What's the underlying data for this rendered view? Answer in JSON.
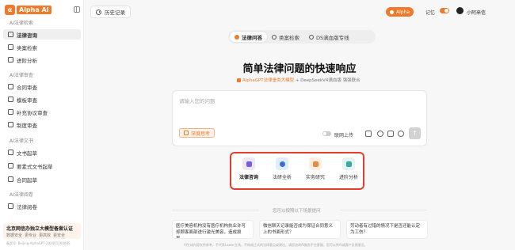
{
  "sidebar": {
    "logo_text": "Alpha AI",
    "sections": [
      {
        "title": "AI法律检索"
      },
      {
        "title": "AI法律审查"
      },
      {
        "title": "AI法律文书"
      },
      {
        "title": "AI法律阅卷"
      }
    ],
    "items": [
      {
        "label": "法律咨询"
      },
      {
        "label": "类案检索"
      },
      {
        "label": "进阶分析"
      },
      {
        "label": "合同审查"
      },
      {
        "label": "模板审查"
      },
      {
        "label": "补充协议审查"
      },
      {
        "label": "制度审查"
      },
      {
        "label": "文书起草"
      },
      {
        "label": "要素式文书起草"
      },
      {
        "label": "合同起草"
      },
      {
        "label": "法律阅卷"
      }
    ],
    "promo": {
      "title": "北京网信办独立大模型备案认证",
      "tags": [
        "数据安全",
        "更专业",
        "更高效",
        "更安全"
      ]
    },
    "beian": "备案号: Beijing-AlphaGPT-20240116008S"
  },
  "topbar": {
    "history_label": "历史记录",
    "alpha_label": "Alpha",
    "memory_label": "记忆",
    "user_name": "小阿来信"
  },
  "tabs": [
    {
      "label": "法律问答"
    },
    {
      "label": "类案检索"
    },
    {
      "label": "DS满血版专线"
    }
  ],
  "main": {
    "headline": "简单法律问题的快速响应",
    "subline_brand": "AlphaGPT法律垂类大模型",
    "subline_rest": " + DeepSeekV4满血版 强强联合"
  },
  "input": {
    "placeholder": "请输入您的问题",
    "deep_think_label": "深度思考",
    "web_upload_label": "联网上传",
    "send_icon": "↑"
  },
  "features": [
    {
      "label": "法律咨询",
      "bg": "#ece7fb",
      "fg": "#7b5be0"
    },
    {
      "label": "法研全析",
      "bg": "#e3ecfb",
      "fg": "#3a6fd8"
    },
    {
      "label": "实务研究",
      "bg": "#fdeee2",
      "fg": "#ea8a3a"
    },
    {
      "label": "进阶分析",
      "bg": "#e2f4f1",
      "fg": "#3aa89a"
    }
  ],
  "suggestions": {
    "title": "您可以按照以下场景提问",
    "cards": [
      {
        "text": "医疗美容机构没有医疗机构执业许可却顾客面部进行激光美容，造成损害..."
      },
      {
        "text": "微信聊天记录能否成为保证合同意义上的书面形式？"
      },
      {
        "text": "劳动者有过错的情况下是否还能认定为工伤？"
      }
    ]
  },
  "footer_note": "AI生成内容仅供参考，不代表Lawor立场，不构成正式的法律意见或建议。请您咨询AI服务平台客服，您可以将AI或客户反馈意见。"
}
